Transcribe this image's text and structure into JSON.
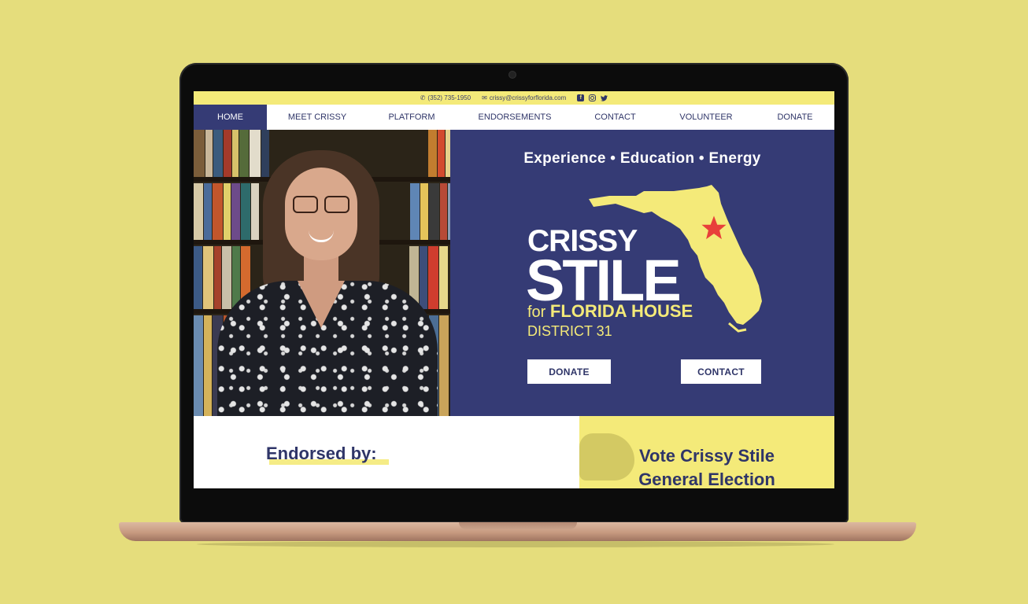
{
  "topbar": {
    "phone": "(352) 735-1950",
    "email": "crissy@crissyforflorida.com",
    "social": [
      "facebook-icon",
      "instagram-icon",
      "twitter-icon"
    ]
  },
  "nav": {
    "items": [
      "HOME",
      "MEET CRISSY",
      "PLATFORM",
      "ENDORSEMENTS",
      "CONTACT",
      "VOLUNTEER",
      "DONATE"
    ],
    "active": "HOME"
  },
  "hero": {
    "tagline": "Experience • Education • Energy",
    "name_first": "CRISSY",
    "name_last": "STILE",
    "for": "for",
    "office": "FLORIDA HOUSE",
    "district": "DISTRICT 31",
    "donate_label": "DONATE",
    "contact_label": "CONTACT"
  },
  "sections": {
    "endorsed_title": "Endorsed by:",
    "vote_line1": "Vote Crissy Stile",
    "vote_line2": "General Election"
  },
  "colors": {
    "navy": "#353b75",
    "yellow": "#f4ea79",
    "star": "#e8403a",
    "background": "#e5dd7c"
  }
}
